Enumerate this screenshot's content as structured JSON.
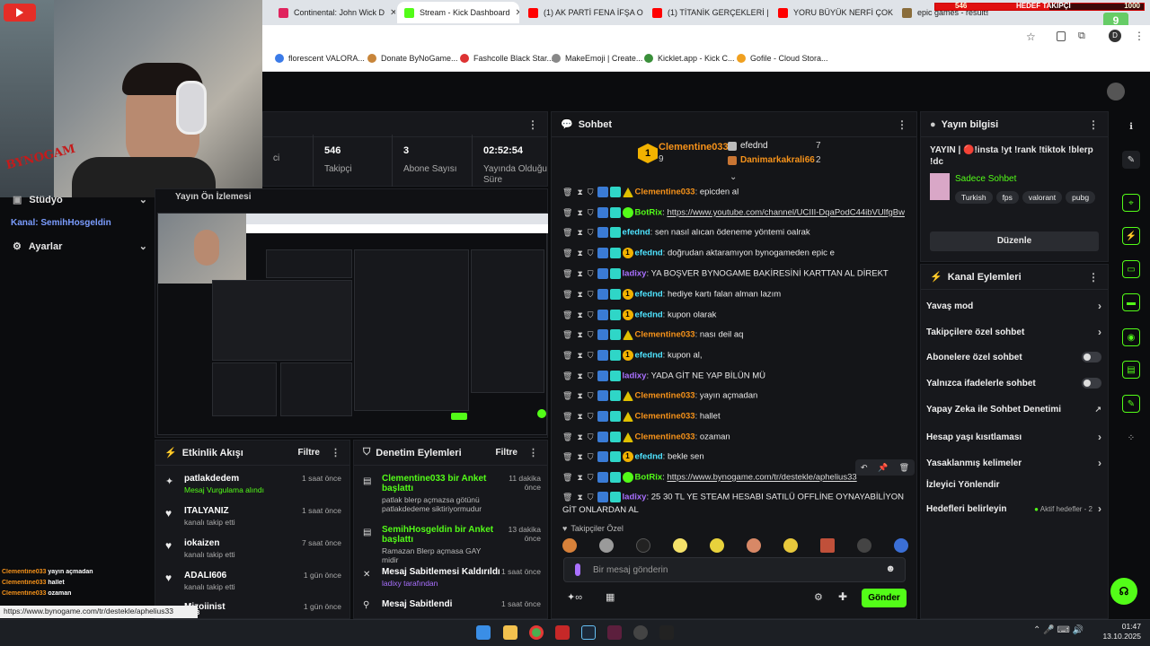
{
  "browser": {
    "tabs": [
      {
        "label": "Continental: John Wick D",
        "color": "#e0245e"
      },
      {
        "label": "Stream - Kick Dashboard",
        "color": "#53fc18"
      },
      {
        "label": "(1) AK PARTİ FENA İFŞA O",
        "color": "#ff0000"
      },
      {
        "label": "(1) TİTANİK GERÇEKLERİ |",
        "color": "#ff0000"
      },
      {
        "label": "YORU BÜYÜK NERFİ ÇOK",
        "color": "#ff0000"
      },
      {
        "label": "epic games - results for",
        "color": "#8a6d3b"
      }
    ],
    "bookmarks": [
      "florescent VALORA...",
      "Donate ByNoGame...",
      "Fashcolle Black Star...",
      "MakeEmoji | Create...",
      "Kicklet.app - Kick C...",
      "Gofile - Cloud Stora..."
    ],
    "overlay_badge": "9",
    "goal_label": "HEDEF TAKİPÇİ",
    "goal_current": "546",
    "goal_target": "1000",
    "goal_progress": 0.546
  },
  "webcam": {
    "brand": "BYNOGAM"
  },
  "sidebar": {
    "studio": "Stüdyo",
    "channel": "Kanal: SemihHosgeldin",
    "settings": "Ayarlar"
  },
  "stats": [
    {
      "value": "",
      "label": "ci"
    },
    {
      "value": "546",
      "label": "Takipçi"
    },
    {
      "value": "3",
      "label": "Abone Sayısı"
    },
    {
      "value": "02:52:54",
      "label": "Yayında Olduğu Süre"
    }
  ],
  "preview_title": "Yayın Ön İzlemesi",
  "activity": {
    "title": "Etkinlik Akışı",
    "filter": "Filtre",
    "items": [
      {
        "name": "patlakdedem",
        "sub": "Mesaj Vurgulama alındı",
        "time": "1 saat önce"
      },
      {
        "name": "ITALYANIZ",
        "sub": "kanalı takip etti",
        "time": "1 saat önce"
      },
      {
        "name": "iokaizen",
        "sub": "kanalı takip etti",
        "time": "7 saat önce"
      },
      {
        "name": "ADALI606",
        "sub": "kanalı takip etti",
        "time": "1 gün önce"
      },
      {
        "name": "Mizoiinist",
        "sub": "",
        "time": "1 gün önce"
      }
    ]
  },
  "moderation": {
    "title": "Denetim Eylemleri",
    "filter": "Filtre",
    "items": [
      {
        "title": "Clementine033 bir Anket başlattı",
        "sub": "patlak blerp açmazsa götünü patlakdedeme siktiriyormudur",
        "time": "11 dakika önce"
      },
      {
        "title": "SemihHosgeldin bir Anket başlattı",
        "sub": "Ramazan Blerp açmasa GAY midir",
        "time": "13 dakika önce"
      },
      {
        "title": "Mesaj Sabitlemesi Kaldırıldı",
        "sub": "ladixy tarafından",
        "time": "1 saat önce"
      },
      {
        "title": "Mesaj Sabitlendi",
        "sub": "",
        "time": "1 saat önce"
      }
    ]
  },
  "chat": {
    "title": "Sohbet",
    "leaderboard": {
      "top": {
        "name": "Clementine033",
        "count": "9",
        "rank": "1"
      },
      "second": {
        "name": "efednd",
        "count": "7"
      },
      "third": {
        "name": "Danimarkakrali66",
        "count": "2"
      }
    },
    "messages": [
      {
        "user": "Clementine033",
        "color": "orange",
        "badge": "warn",
        "text": "epicden al"
      },
      {
        "user": "BotRix",
        "color": "green",
        "badge": "ver",
        "text": "https://www.youtube.com/channel/UCIII-DqaPodC44ibVUlfgBw",
        "link": true
      },
      {
        "user": "efednd",
        "color": "cyan",
        "badge": "none",
        "text": "sen nasıl alıcan ödeneme yöntemi oalrak"
      },
      {
        "user": "efednd",
        "color": "cyan",
        "badge": "gold",
        "text": "doğrudan aktaramıyon bynogameden epic e"
      },
      {
        "user": "ladixy",
        "color": "purple",
        "badge": "none",
        "text": "YA BOŞVER BYNOGAME BAKİRESİNİ KARTTAN AL DİREKT"
      },
      {
        "user": "efednd",
        "color": "cyan",
        "badge": "gold",
        "text": "hediye kartı falan alman lazım"
      },
      {
        "user": "efednd",
        "color": "cyan",
        "badge": "gold",
        "text": "kupon olarak"
      },
      {
        "user": "Clementine033",
        "color": "orange",
        "badge": "warn",
        "text": "nası deil aq"
      },
      {
        "user": "efednd",
        "color": "cyan",
        "badge": "gold",
        "text": "kupon al,"
      },
      {
        "user": "ladixy",
        "color": "purple",
        "badge": "none",
        "text": "YADA GİT NE YAP BİLÜN MÜ"
      },
      {
        "user": "Clementine033",
        "color": "orange",
        "badge": "warn",
        "text": "yayın açmadan"
      },
      {
        "user": "Clementine033",
        "color": "orange",
        "badge": "warn",
        "text": "hallet"
      },
      {
        "user": "Clementine033",
        "color": "orange",
        "badge": "warn",
        "text": "ozaman"
      },
      {
        "user": "efednd",
        "color": "cyan",
        "badge": "gold",
        "text": "bekle sen"
      },
      {
        "user": "BotRix",
        "color": "green",
        "badge": "ver",
        "text": "https://www.bynogame.com/tr/destekle/aphelius33",
        "link": true
      },
      {
        "user": "ladixy",
        "color": "purple",
        "badge": "none",
        "text": "25 30 TL YE STEAM HESABI SATILÜ OFFLİNE OYNAYABİLİYON GİT ONLARDAN AL"
      }
    ],
    "followers_only": "Takipçiler Özel",
    "input_placeholder": "Bir mesaj gönderin",
    "send": "Gönder"
  },
  "stream_info": {
    "title": "Yayın bilgisi",
    "stream_title": "YAYIN | 🔴!insta !yt !rank !tiktok !blerp !dc",
    "category": "Sadece Sohbet",
    "tags": [
      "Turkish",
      "fps",
      "valorant",
      "pubg"
    ],
    "edit": "Düzenle"
  },
  "channel_actions": {
    "title": "Kanal Eylemleri",
    "rows": [
      {
        "label": "Yavaş mod",
        "type": "chevron"
      },
      {
        "label": "Takipçilere özel sohbet",
        "type": "chevron"
      },
      {
        "label": "Abonelere özel sohbet",
        "type": "toggle"
      },
      {
        "label": "Yalnızca ifadelerle sohbet",
        "type": "toggle"
      },
      {
        "label": "Yapay Zeka ile Sohbet Denetimi",
        "type": "ext"
      },
      {
        "label": "Hesap yaşı kısıtlaması",
        "type": "chevron"
      },
      {
        "label": "Yasaklanmış kelimeler",
        "type": "chevron"
      },
      {
        "label": "İzleyici Yönlendir",
        "type": "none"
      },
      {
        "label": "Hedefleri belirleyin",
        "type": "chevron",
        "extra": "Aktif hedefler - 2"
      }
    ]
  },
  "overlay_chat": [
    {
      "user": "Clementine033",
      "text": "yayın açmadan"
    },
    {
      "user": "Clementine033",
      "text": "hallet"
    },
    {
      "user": "Clementine033",
      "text": "ozaman"
    },
    {
      "user": "BotRix",
      "text": "https://www.bynogame.com/tr/destekle/aphelius33"
    },
    {
      "user": "ladixy",
      "text": "25 30 TL YE STEAM HESABI SATILÜ OFFLİNE OYNAYABİLİYON GİT ONLARDAN AL"
    }
  ],
  "status_url": "https://www.bynogame.com/tr/destekle/aphelius33",
  "taskbar": {
    "time": "01:47",
    "date": "13.10.2025"
  }
}
